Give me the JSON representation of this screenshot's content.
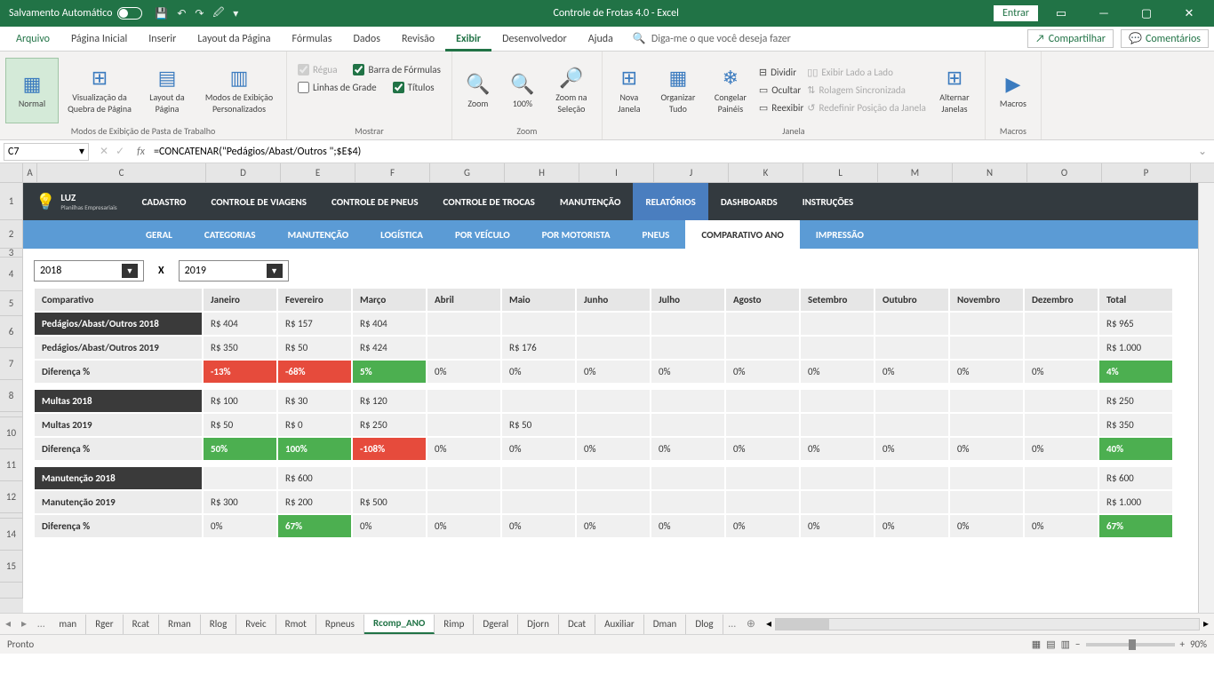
{
  "titlebar": {
    "autosave": "Salvamento Automático",
    "title": "Controle de Frotas 4.0  -  Excel",
    "signin": "Entrar"
  },
  "ribtabs": {
    "file": "Arquivo",
    "tabs": [
      "Página Inicial",
      "Inserir",
      "Layout da Página",
      "Fórmulas",
      "Dados",
      "Revisão",
      "Exibir",
      "Desenvolvedor",
      "Ajuda"
    ],
    "active": "Exibir",
    "tellme": "Diga-me o que você deseja fazer",
    "share": "Compartilhar",
    "comments": "Comentários"
  },
  "ribbon": {
    "g1": {
      "normal": "Normal",
      "quebra": "Visualização da Quebra de Página",
      "layout": "Layout da Página",
      "modos": "Modos de Exibição Personalizados",
      "label": "Modos de Exibição de Pasta de Trabalho"
    },
    "g2": {
      "regua": "Régua",
      "formulas": "Barra de Fórmulas",
      "linhas": "Linhas de Grade",
      "titulos": "Títulos",
      "label": "Mostrar"
    },
    "g3": {
      "zoom": "Zoom",
      "cem": "100%",
      "sel": "Zoom na Seleção",
      "label": "Zoom"
    },
    "g4": {
      "nova": "Nova Janela",
      "org": "Organizar Tudo",
      "cong": "Congelar Painéis",
      "div": "Dividir",
      "ocu": "Ocultar",
      "reex": "Reexibir",
      "lado": "Exibir Lado a Lado",
      "rol": "Rolagem Sincronizada",
      "red": "Redefinir Posição da Janela",
      "alt": "Alternar Janelas",
      "label": "Janela"
    },
    "g5": {
      "macros": "Macros",
      "label": "Macros"
    }
  },
  "fbar": {
    "cell": "C7",
    "formula": "=CONCATENAR(\"Pedágios/Abast/Outros \";$E$4)"
  },
  "cols": [
    "A",
    "C",
    "D",
    "E",
    "F",
    "G",
    "H",
    "I",
    "J",
    "K",
    "L",
    "M",
    "N",
    "O",
    "P"
  ],
  "rows": [
    "1",
    "2",
    "3",
    "4",
    "5",
    "6",
    "7",
    "8",
    "",
    "10",
    "11",
    "12",
    "",
    "14",
    "15",
    ""
  ],
  "appnav": {
    "luz": "LUZ",
    "luz2": "Planilhas Empresariais",
    "items": [
      "CADASTRO",
      "CONTROLE DE VIAGENS",
      "CONTROLE DE PNEUS",
      "CONTROLE DE TROCAS",
      "MANUTENÇÃO",
      "RELATÓRIOS",
      "DASHBOARDS",
      "INSTRUÇÕES"
    ],
    "active": "RELATÓRIOS"
  },
  "subnav": {
    "items": [
      "GERAL",
      "CATEGORIAS",
      "MANUTENÇÃO",
      "LOGÍSTICA",
      "POR VEÍCULO",
      "POR MOTORISTA",
      "PNEUS",
      "COMPARATIVO ANO",
      "IMPRESSÃO"
    ],
    "active": "COMPARATIVO ANO"
  },
  "yearsel": {
    "y1": "2018",
    "x": "X",
    "y2": "2019"
  },
  "table": {
    "headers": [
      "Comparativo",
      "Janeiro",
      "Fevereiro",
      "Março",
      "Abril",
      "Maio",
      "Junho",
      "Julho",
      "Agosto",
      "Setembro",
      "Outubro",
      "Novembro",
      "Dezembro",
      "Total"
    ],
    "sections": [
      {
        "title": "Pedágios/Abast/Outros 2018",
        "vals": [
          "R$ 404",
          "R$ 157",
          "R$ 404",
          "",
          "",
          "",
          "",
          "",
          "",
          "",
          "",
          "",
          "R$ 965"
        ],
        "title2": "Pedágios/Abast/Outros 2019",
        "vals2": [
          "R$ 350",
          "R$ 50",
          "R$ 424",
          "",
          "R$ 176",
          "",
          "",
          "",
          "",
          "",
          "",
          "",
          "R$ 1.000"
        ],
        "diff": "Diferença %",
        "pcts": [
          "-13%",
          "-68%",
          "5%",
          "0%",
          "0%",
          "0%",
          "0%",
          "0%",
          "0%",
          "0%",
          "0%",
          "0%",
          "4%"
        ],
        "colors": [
          "r",
          "r",
          "g",
          "",
          "",
          "",
          "",
          "",
          "",
          "",
          "",
          "",
          "g"
        ]
      },
      {
        "title": "Multas 2018",
        "vals": [
          "R$ 100",
          "R$ 30",
          "R$ 120",
          "",
          "",
          "",
          "",
          "",
          "",
          "",
          "",
          "",
          "R$ 250"
        ],
        "title2": "Multas 2019",
        "vals2": [
          "R$ 50",
          "R$ 0",
          "R$ 250",
          "",
          "R$ 50",
          "",
          "",
          "",
          "",
          "",
          "",
          "",
          "R$ 350"
        ],
        "diff": "Diferença %",
        "pcts": [
          "50%",
          "100%",
          "-108%",
          "0%",
          "0%",
          "0%",
          "0%",
          "0%",
          "0%",
          "0%",
          "0%",
          "0%",
          "40%"
        ],
        "colors": [
          "g",
          "g",
          "r",
          "",
          "",
          "",
          "",
          "",
          "",
          "",
          "",
          "",
          "g"
        ]
      },
      {
        "title": "Manutenção 2018",
        "vals": [
          "",
          "R$ 600",
          "",
          "",
          "",
          "",
          "",
          "",
          "",
          "",
          "",
          "",
          "R$ 600"
        ],
        "title2": "Manutenção 2019",
        "vals2": [
          "R$ 300",
          "R$ 200",
          "R$ 500",
          "",
          "",
          "",
          "",
          "",
          "",
          "",
          "",
          "",
          "R$ 1.000"
        ],
        "diff": "Diferença %",
        "pcts": [
          "0%",
          "67%",
          "0%",
          "0%",
          "0%",
          "0%",
          "0%",
          "0%",
          "0%",
          "0%",
          "0%",
          "0%",
          "67%"
        ],
        "colors": [
          "",
          "g",
          "",
          "",
          "",
          "",
          "",
          "",
          "",
          "",
          "",
          "",
          "g"
        ]
      }
    ]
  },
  "sheets": {
    "tabs": [
      "man",
      "Rger",
      "Rcat",
      "Rman",
      "Rlog",
      "Rveic",
      "Rmot",
      "Rpneus",
      "Rcomp_ANO",
      "Rimp",
      "Dgeral",
      "Djorn",
      "Dcat",
      "Auxiliar",
      "Dman",
      "Dlog"
    ],
    "active": "Rcomp_ANO"
  },
  "status": {
    "ready": "Pronto",
    "zoom": "90%"
  }
}
